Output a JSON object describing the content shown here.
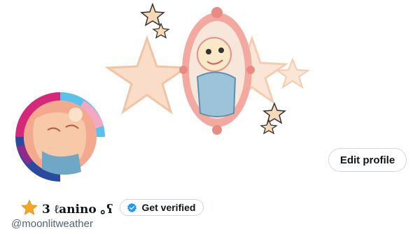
{
  "profile": {
    "display_name": "3 ℓanino ｡ʕ",
    "handle": "@moonlitweather",
    "name_emoji": "star-icon"
  },
  "actions": {
    "edit_profile_label": "Edit profile",
    "get_verified_label": "Get verified"
  },
  "colors": {
    "verified_blue": "#1d9bf0",
    "star_gold": "#f5a623",
    "text_primary": "#0f1419",
    "text_secondary": "#536471",
    "button_border": "#cfd9de"
  }
}
